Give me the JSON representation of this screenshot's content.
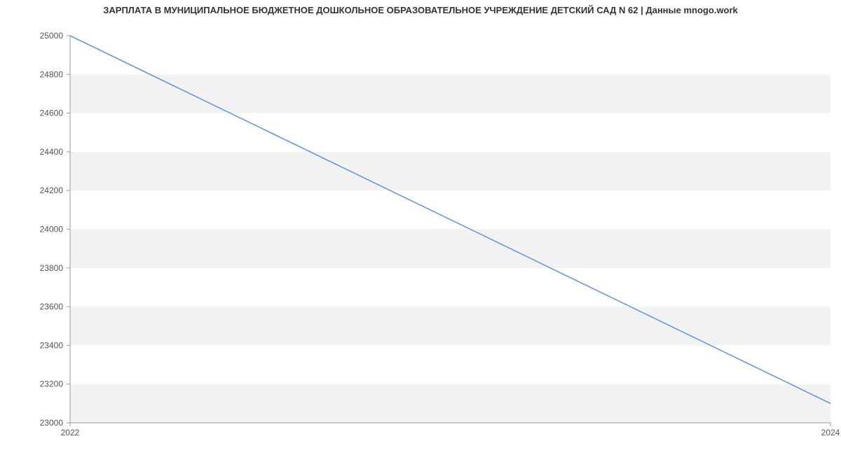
{
  "chart_data": {
    "type": "line",
    "title": "ЗАРПЛАТА В МУНИЦИПАЛЬНОЕ БЮДЖЕТНОЕ ДОШКОЛЬНОЕ ОБРАЗОВАТЕЛЬНОЕ УЧРЕЖДЕНИЕ ДЕТСКИЙ САД N 62 | Данные mnogo.work",
    "x": [
      2022,
      2024
    ],
    "values": [
      25000,
      23100
    ],
    "xlabel": "",
    "ylabel": "",
    "xticks": [
      "2022",
      "2024"
    ],
    "yticks": [
      "23000",
      "23200",
      "23400",
      "23600",
      "23800",
      "24000",
      "24200",
      "24400",
      "24600",
      "24800",
      "25000"
    ],
    "ylim": [
      23000,
      25000
    ],
    "xlim": [
      2022,
      2024
    ],
    "grid_bands": true,
    "line_color": "#6699e0"
  }
}
